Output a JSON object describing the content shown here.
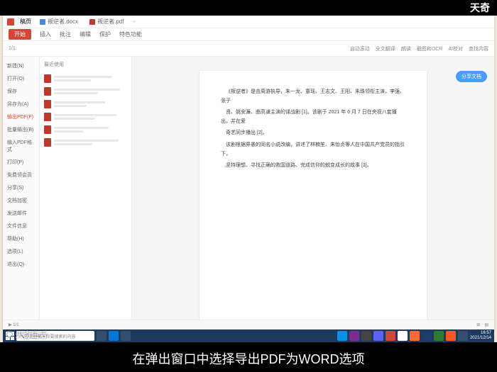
{
  "brand_top": "天奇",
  "watermark": "◉ 天奇生活",
  "subtitle": "在弹出窗口中选择导出PDF为WORD选项",
  "titlebar": {
    "app_name": "稿页",
    "tab1": "叛逆者.docx",
    "tab2": "叛逆者.pdf"
  },
  "ribbon": {
    "items": [
      "开始",
      "插入",
      "批注",
      "编辑",
      "保护",
      "特色功能"
    ]
  },
  "toolbar": {
    "left": [
      "新建",
      "打开",
      "✓"
    ],
    "page": "1/1",
    "right": [
      "自动滚动",
      "全文翻译",
      "朗读",
      "截图和OCR",
      "AI校对",
      "查找内容"
    ]
  },
  "file_menu": [
    {
      "label": "新建(N)",
      "hl": false
    },
    {
      "label": "打开(O)",
      "hl": false
    },
    {
      "label": "保存",
      "hl": false
    },
    {
      "label": "另存为(A)",
      "hl": false
    },
    {
      "label": "输出PDF(F)",
      "hl": true
    },
    {
      "label": "批量输出(B)",
      "hl": false
    },
    {
      "label": "输入PDF格式",
      "hl": false
    },
    {
      "label": "打印(P)",
      "hl": false
    },
    {
      "label": "免费领会员",
      "hl": false
    },
    {
      "label": "分享(S)",
      "hl": false
    },
    {
      "label": "文档加密",
      "hl": false
    },
    {
      "label": "发送邮件",
      "hl": false
    },
    {
      "label": "文件信息",
      "hl": false
    },
    {
      "label": "帮助(H)",
      "hl": false
    },
    {
      "label": "选项(L)",
      "hl": false
    },
    {
      "label": "退出(Q)",
      "hl": false
    }
  ],
  "recent": {
    "header": "最近使用"
  },
  "document": {
    "p1": "《叛逆者》是由周游执导，朱一龙、童瑶、王志文、王阳、朱珠领衔主演，李强、张子",
    "p2": "贤、姚安濂、曲高谦主演的谍战剧 [1]。该剧于 2021 年 6 月 7 日在央视八套播出，并在爱",
    "p3": "奇艺同步播出 [2]。",
    "p4": "该剧根据畀愚的同名小说改编，讲述了林楠笙、朱怡贞等人在中国共产党员的指引下，",
    "p5": "坚持理想、寻找正确的救国道路、完成信仰的蜕变成长的故事 [3]。"
  },
  "share_btn": "分享文档",
  "search": {
    "placeholder": "在这里输入你要搜索的内容"
  },
  "tray": {
    "time": "16:57",
    "date": "2021/12/14"
  },
  "statusbar": {
    "page": "▶ 1/1"
  }
}
